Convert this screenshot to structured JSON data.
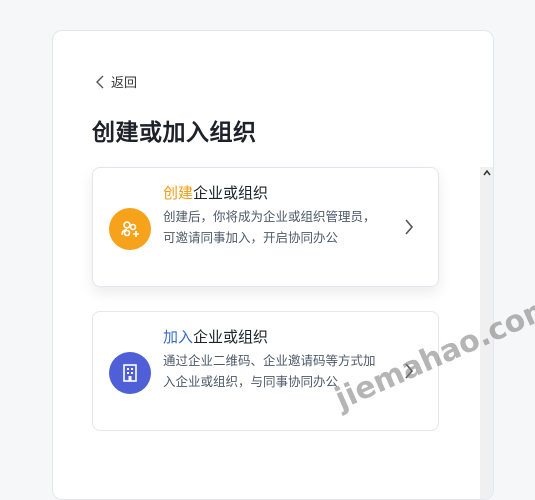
{
  "back": {
    "label": "返回"
  },
  "page_title": "创建或加入组织",
  "options": [
    {
      "accent": "创建",
      "rest": "企业或组织",
      "description": "创建后，你将成为企业或组织管理员，可邀请同事加入，开启协同办公",
      "icon": "team-add-icon",
      "color": "#f7a21b"
    },
    {
      "accent": "加入",
      "rest": "企业或组织",
      "description": "通过企业二维码、企业邀请码等方式加入企业或组织，与同事协同办公",
      "icon": "building-icon",
      "color": "#4e5fd8"
    }
  ],
  "watermark": "jiemahao.com"
}
